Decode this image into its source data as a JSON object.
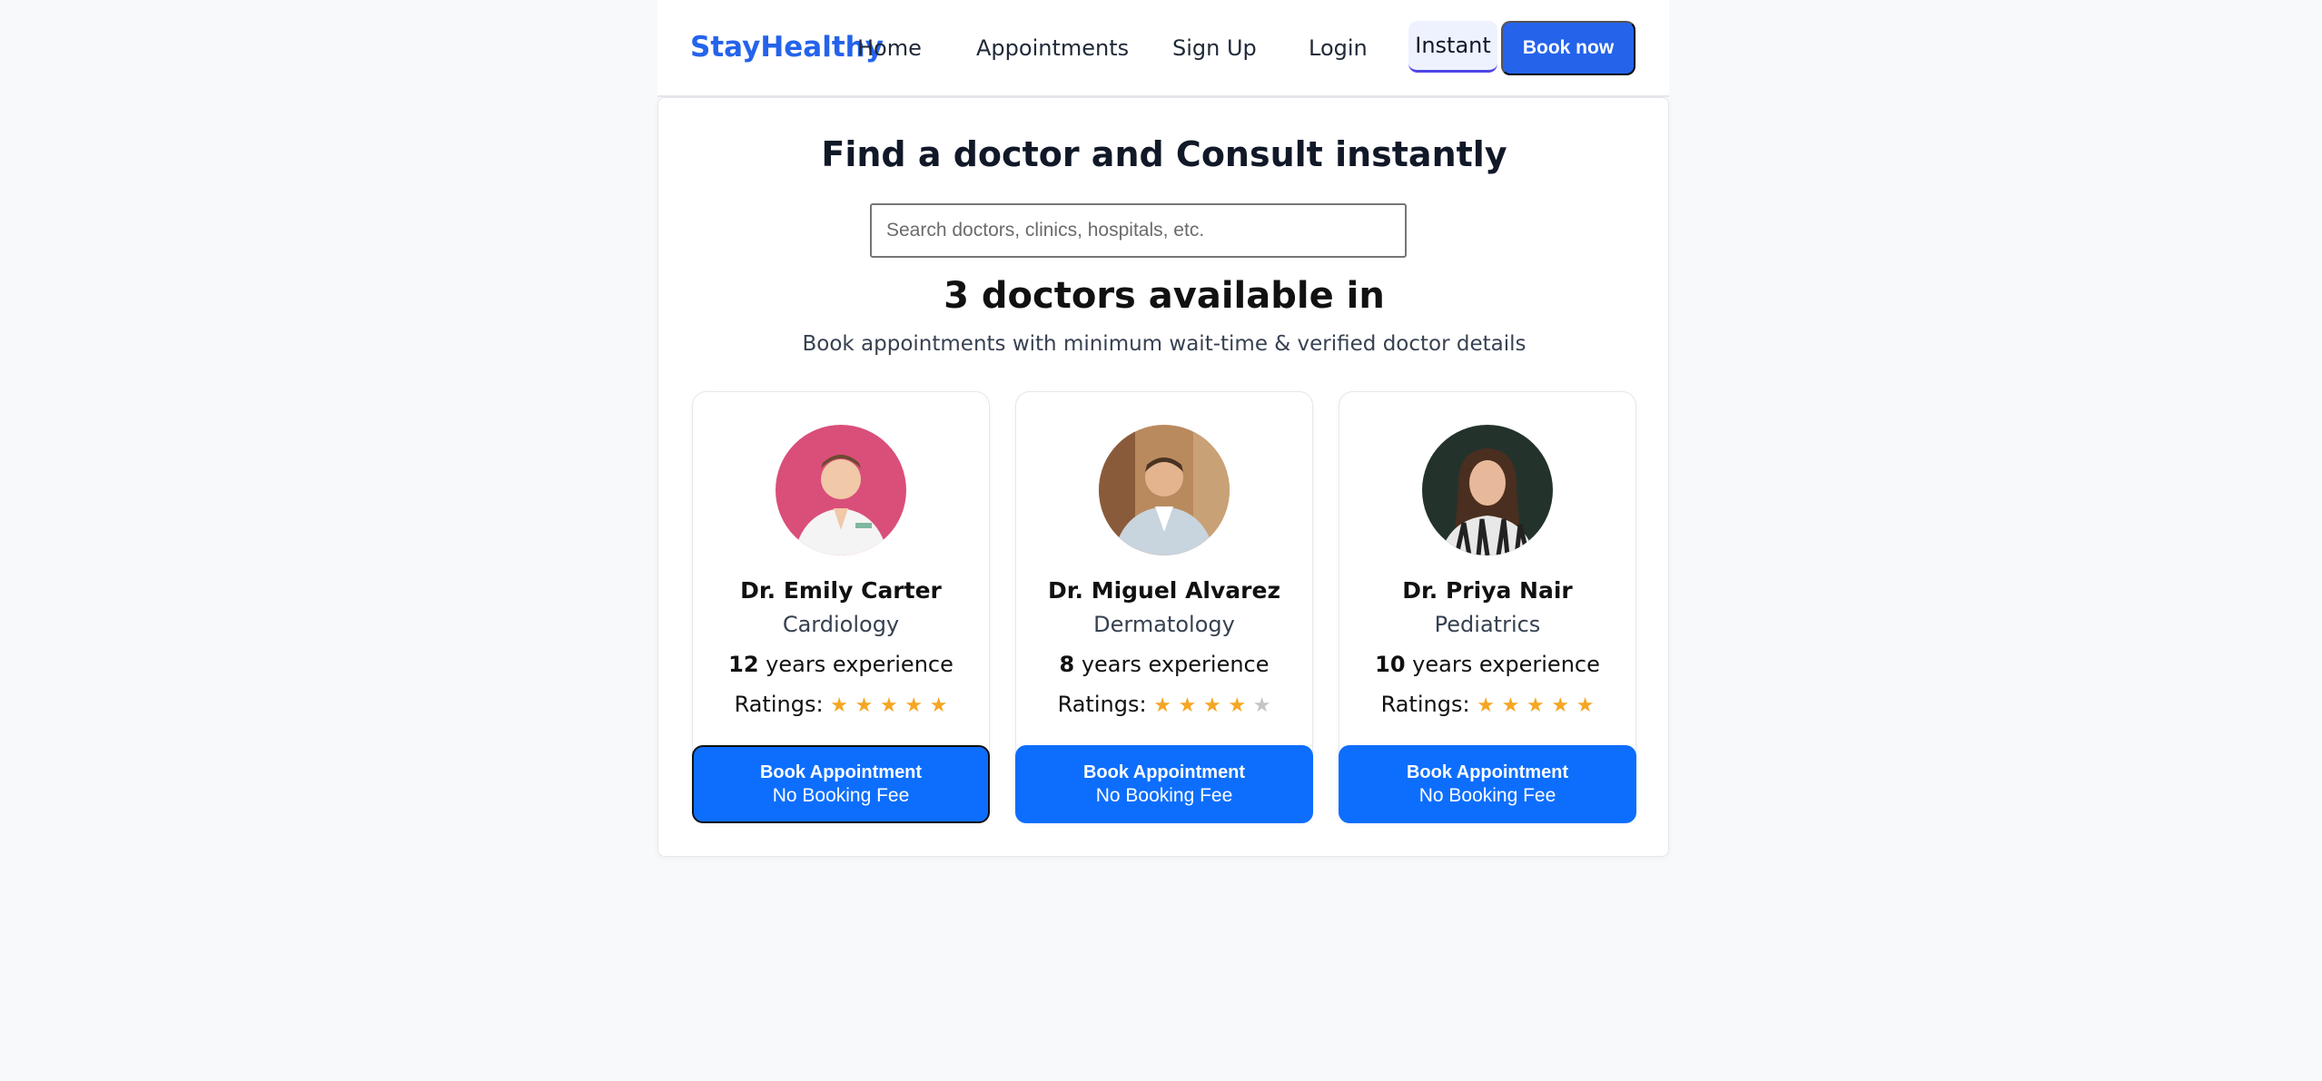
{
  "nav": {
    "brand": "StayHealthy",
    "links": [
      "Home",
      "Appointments",
      "Sign Up",
      "Login"
    ],
    "instant_label": "Instant",
    "book_now_label": "Book now"
  },
  "main": {
    "title": "Find a doctor and Consult instantly",
    "search_placeholder": "Search doctors, clinics, hospitals, etc.",
    "count_heading": "3 doctors available in",
    "subtitle": "Book appointments with minimum wait-time & verified doctor details"
  },
  "doctors": [
    {
      "name": "Dr. Emily Carter",
      "specialty": "Cardiology",
      "years": "12",
      "experience_suffix": "years experience",
      "ratings_label": "Ratings:",
      "rating": 5,
      "button_line1": "Book Appointment",
      "button_line2": "No Booking Fee"
    },
    {
      "name": "Dr. Miguel Alvarez",
      "specialty": "Dermatology",
      "years": "8",
      "experience_suffix": "years experience",
      "ratings_label": "Ratings:",
      "rating": 4,
      "button_line1": "Book Appointment",
      "button_line2": "No Booking Fee"
    },
    {
      "name": "Dr. Priya Nair",
      "specialty": "Pediatrics",
      "years": "10",
      "experience_suffix": "years experience",
      "ratings_label": "Ratings:",
      "rating": 5,
      "button_line1": "Book Appointment",
      "button_line2": "No Booking Fee"
    }
  ],
  "colors": {
    "brand": "#2563eb",
    "button": "#0d6efd",
    "star": "#f5a623",
    "star_off": "#c4c4c4"
  }
}
